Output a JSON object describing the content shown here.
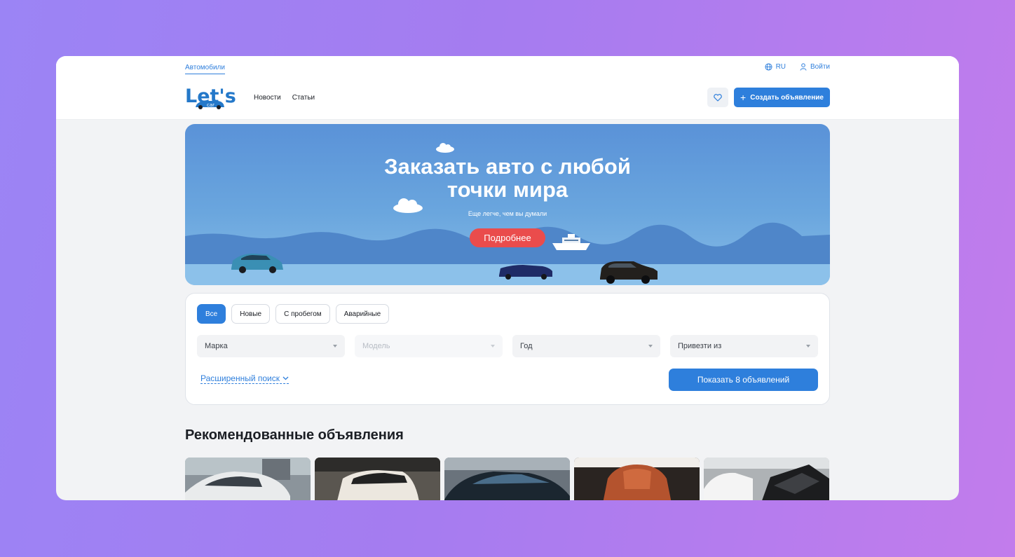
{
  "header": {
    "breadcrumb": "Автомобили",
    "language": "RU",
    "login": "Войти",
    "logo_text": "Let's",
    "logo_sub": "car",
    "nav": [
      "Новости",
      "Статьи"
    ],
    "create_label": "Создать объявление"
  },
  "hero": {
    "title_line1": "Заказать авто с любой",
    "title_line2": "точки мира",
    "subtitle": "Еще легче, чем вы думали",
    "cta": "Подробнее"
  },
  "filters": {
    "tabs": [
      "Все",
      "Новые",
      "С пробегом",
      "Аварийные"
    ],
    "selects": {
      "brand": "Марка",
      "model": "Модель",
      "year": "Год",
      "import_from": "Привезти из"
    },
    "advanced": "Расширенный поиск",
    "show": "Показать 8 объявлений"
  },
  "recommended": {
    "title": "Рекомендованные объявления"
  },
  "colors": {
    "accent": "#2e7fdc",
    "cta_red": "#ea4c4c"
  }
}
